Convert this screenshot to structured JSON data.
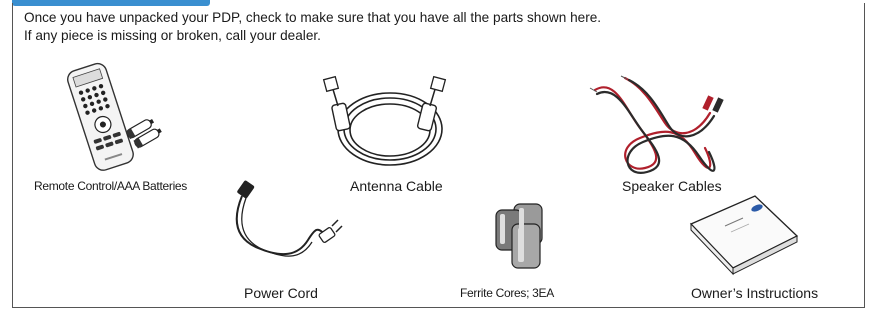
{
  "intro": {
    "line1": "Once you have unpacked your PDP, check to make sure that you have all the parts shown here.",
    "line2": "If any piece is missing or broken, call your dealer."
  },
  "parts": {
    "remote": "Remote Control/AAA Batteries",
    "antenna": "Antenna Cable",
    "speaker": "Speaker Cables",
    "power": "Power Cord",
    "ferrite": "Ferrite Cores; 3EA",
    "manual": "Owner’s Instructions"
  },
  "colors": {
    "accent_tab": "#3a8fd0",
    "speaker_red": "#b0202c",
    "speaker_black": "#2b2b2b"
  }
}
